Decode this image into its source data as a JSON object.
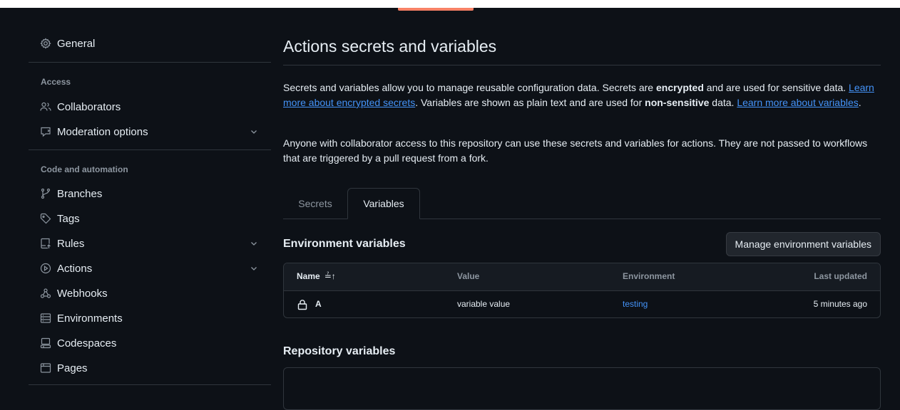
{
  "sidebar": {
    "general": {
      "label": "General",
      "icon": "gear-icon"
    },
    "access": {
      "heading": "Access",
      "items": [
        {
          "label": "Collaborators",
          "icon": "people-icon"
        },
        {
          "label": "Moderation options",
          "icon": "report-icon",
          "expandable": true
        }
      ]
    },
    "code_automation": {
      "heading": "Code and automation",
      "items": [
        {
          "label": "Branches",
          "icon": "git-branch-icon"
        },
        {
          "label": "Tags",
          "icon": "tag-icon"
        },
        {
          "label": "Rules",
          "icon": "repo-push-icon",
          "expandable": true
        },
        {
          "label": "Actions",
          "icon": "play-icon",
          "expandable": true
        },
        {
          "label": "Webhooks",
          "icon": "webhook-icon"
        },
        {
          "label": "Environments",
          "icon": "server-icon"
        },
        {
          "label": "Codespaces",
          "icon": "codespaces-icon"
        },
        {
          "label": "Pages",
          "icon": "browser-icon"
        }
      ]
    }
  },
  "main": {
    "title": "Actions secrets and variables",
    "description": {
      "p1_a": "Secrets and variables allow you to manage reusable configuration data. Secrets are ",
      "p1_b": "encrypted",
      "p1_c": " and are used for sensitive data. ",
      "p1_link1": "Learn more about encrypted secrets",
      "p1_d": ". Variables are shown as plain text and are used for ",
      "p1_e": "non-sensitive",
      "p1_f": " data. ",
      "p1_link2": "Learn more about variables",
      "p1_g": ".",
      "p2": "Anyone with collaborator access to this repository can use these secrets and variables for actions. They are not passed to workflows that are triggered by a pull request from a fork."
    },
    "tabs": [
      {
        "label": "Secrets",
        "active": false
      },
      {
        "label": "Variables",
        "active": true
      }
    ],
    "env_section": {
      "title": "Environment variables",
      "manage_button": "Manage environment variables",
      "columns": {
        "name": "Name",
        "sort_glyph": "≟↑",
        "value": "Value",
        "environment": "Environment",
        "updated": "Last updated"
      },
      "rows": [
        {
          "name": "A",
          "value": "variable value",
          "environment": "testing",
          "updated": "5 minutes ago"
        }
      ]
    },
    "repo_section": {
      "title": "Repository variables"
    }
  },
  "colors": {
    "accent_link": "#4493f8",
    "tab_underline": "#f78166",
    "background": "#0d1117",
    "border": "#30363d"
  }
}
